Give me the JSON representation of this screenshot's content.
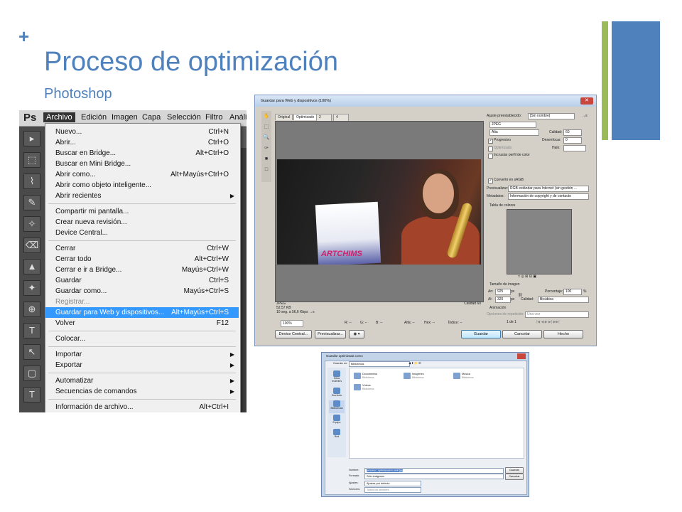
{
  "slide": {
    "plus": "+",
    "title": "Proceso de optimización",
    "subtitle": "Photoshop",
    "accent_color": "#4f81bd",
    "secondary_accent_color": "#9bbb59"
  },
  "photoshop_menu": {
    "logo": "Ps",
    "menubar": [
      "Archivo",
      "Edición",
      "Imagen",
      "Capa",
      "Selección",
      "Filtro",
      "Anális"
    ],
    "active_menu": "Archivo",
    "items": [
      {
        "label": "Nuevo...",
        "shortcut": "Ctrl+N"
      },
      {
        "label": "Abrir...",
        "shortcut": "Ctrl+O"
      },
      {
        "label": "Buscar en Bridge...",
        "shortcut": "Alt+Ctrl+O"
      },
      {
        "label": "Buscar en Mini Bridge...",
        "shortcut": ""
      },
      {
        "label": "Abrir como...",
        "shortcut": "Alt+Mayús+Ctrl+O"
      },
      {
        "label": "Abrir como objeto inteligente...",
        "shortcut": ""
      },
      {
        "label": "Abrir recientes",
        "shortcut": "",
        "submenu": true
      },
      {
        "label": "Compartir mi pantalla...",
        "shortcut": ""
      },
      {
        "label": "Crear nueva revisión...",
        "shortcut": ""
      },
      {
        "label": "Device Central...",
        "shortcut": ""
      },
      {
        "label": "Cerrar",
        "shortcut": "Ctrl+W"
      },
      {
        "label": "Cerrar todo",
        "shortcut": "Alt+Ctrl+W"
      },
      {
        "label": "Cerrar e ir a Bridge...",
        "shortcut": "Mayús+Ctrl+W"
      },
      {
        "label": "Guardar",
        "shortcut": "Ctrl+S"
      },
      {
        "label": "Guardar como...",
        "shortcut": "Mayús+Ctrl+S"
      },
      {
        "label": "Registrar...",
        "shortcut": "",
        "disabled": true
      },
      {
        "label": "Guardar para Web y dispositivos...",
        "shortcut": "Alt+Mayús+Ctrl+S",
        "highlighted": true
      },
      {
        "label": "Volver",
        "shortcut": "F12"
      },
      {
        "label": "Colocar...",
        "shortcut": ""
      },
      {
        "label": "Importar",
        "shortcut": "",
        "submenu": true
      },
      {
        "label": "Exportar",
        "shortcut": "",
        "submenu": true
      },
      {
        "label": "Automatizar",
        "shortcut": "",
        "submenu": true
      },
      {
        "label": "Secuencias de comandos",
        "shortcut": "",
        "submenu": true
      },
      {
        "label": "Información de archivo...",
        "shortcut": "Alt+Ctrl+I"
      }
    ],
    "submenu_glyph": "▶",
    "highlight_color": "#3399ff",
    "tool_glyphs": [
      "▸",
      "⬚",
      "⌇",
      "✎",
      "✧",
      "⌫",
      "▲",
      "✦",
      "⊕",
      "T",
      "↖",
      "▢",
      "T"
    ]
  },
  "save_for_web": {
    "window_title": "Guardar para Web y dispositivos (100%)",
    "close_glyph": "✕",
    "tabs": [
      "Original",
      "Optimizado",
      "2 copias",
      "4 copias"
    ],
    "active_tab": "Optimizado",
    "poster_text": "ARTCHIMS",
    "status_left": [
      "JPEG",
      "52,57 KB",
      "10 seg. a 56,6 Kbps →≡"
    ],
    "status_right": "Calidad 60",
    "zoom": "100%",
    "readouts": [
      "R: --",
      "G: --",
      "B: --",
      "Alfa: --",
      "Hex: --",
      "Índice: --"
    ],
    "tool_glyphs": [
      "✋",
      "⬚",
      "🔍",
      "✑",
      "■",
      "□"
    ],
    "preset_label": "Ajuste preestablecido:",
    "preset_value": "[Sin nombre]",
    "format": "JPEG",
    "quality_label": "Alta",
    "calidad_label": "Calidad:",
    "calidad_value": "60",
    "progresivo": "Progresivo",
    "desenfocar_label": "Desenfocar:",
    "desenfocar_value": "0",
    "optimizado": "Optimizado",
    "halo_label": "Halo:",
    "incrustar": "Incrustar perfil de color",
    "convertir": "Convertir en sRGB",
    "previsualizar_label": "Previsualizar:",
    "previsualizar_value": "RGB estándar para Internet (sin gestión ...",
    "metadatos_label": "Metadatos:",
    "metadatos_value": "Información de copyright y de contacto",
    "tabla_colores": "Tabla de colores",
    "tamano_imagen": "Tamaño de imagen",
    "an_label": "An:",
    "an_value": "925",
    "al_label": "Al:",
    "al_value": "320",
    "px": "px",
    "porcentaje_label": "Porcentaje:",
    "porcentaje_value": "100",
    "percent": "%",
    "calidad2_label": "Calidad:",
    "calidad2_value": "Bicúbica",
    "animacion": "Animación",
    "repeticion_label": "Opciones de repetición:",
    "repeticion_value": "Una vez",
    "frame": "1 de 1",
    "buttons": {
      "device_central": "Device Central...",
      "previsualizar": "Previsualizar...",
      "guardar": "Guardar",
      "cancelar": "Cancelar",
      "hecho": "Hecho"
    }
  },
  "save_dialog": {
    "title": "Guardar optimizada como",
    "guardar_en_label": "Guardar en:",
    "guardar_en_value": "Bibliotecas",
    "places": [
      "Sitios recientes",
      "Escritorio",
      "Bibliotecas",
      "Equipo",
      "Red"
    ],
    "libraries": [
      {
        "name": "Documentos",
        "sub": "Biblioteca"
      },
      {
        "name": "Imágenes",
        "sub": "Biblioteca"
      },
      {
        "name": "Música",
        "sub": "Biblioteca"
      },
      {
        "name": "Vídeos",
        "sub": "Biblioteca"
      }
    ],
    "nombre_label": "Nombre:",
    "nombre_value": "proceso_optimizacion-web.jpg",
    "formato_label": "Formato:",
    "formato_value": "Sólo imágenes",
    "ajustes_label": "Ajustes:",
    "ajustes_value": "Ajustes por defecto",
    "sectores_label": "Sectores:",
    "sectores_value": "Todos los sectores",
    "guardar_btn": "Guardar",
    "cancelar_btn": "Cancelar"
  }
}
